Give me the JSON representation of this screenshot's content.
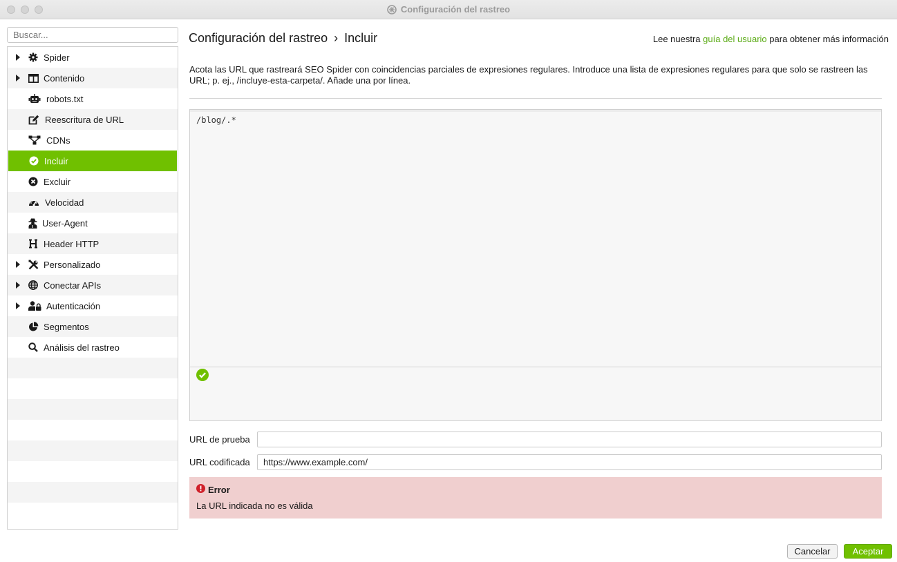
{
  "window": {
    "title": "Configuración del rastreo"
  },
  "sidebar": {
    "search_placeholder": "Buscar...",
    "items": [
      {
        "label": "Spider",
        "icon": "gear-icon",
        "expandable": true,
        "active": false
      },
      {
        "label": "Contenido",
        "icon": "columns-icon",
        "expandable": true,
        "active": false
      },
      {
        "label": "robots.txt",
        "icon": "robot-icon",
        "expandable": false,
        "active": false
      },
      {
        "label": "Reescritura de URL",
        "icon": "edit-icon",
        "expandable": false,
        "active": false
      },
      {
        "label": "CDNs",
        "icon": "network-icon",
        "expandable": false,
        "active": false
      },
      {
        "label": "Incluir",
        "icon": "check-circle-icon",
        "expandable": false,
        "active": true
      },
      {
        "label": "Excluir",
        "icon": "x-circle-icon",
        "expandable": false,
        "active": false
      },
      {
        "label": "Velocidad",
        "icon": "gauge-icon",
        "expandable": false,
        "active": false
      },
      {
        "label": "User-Agent",
        "icon": "user-secret-icon",
        "expandable": false,
        "active": false
      },
      {
        "label": "Header HTTP",
        "icon": "header-h-icon",
        "expandable": false,
        "active": false
      },
      {
        "label": "Personalizado",
        "icon": "tools-icon",
        "expandable": true,
        "active": false
      },
      {
        "label": "Conectar APIs",
        "icon": "globe-icon",
        "expandable": true,
        "active": false
      },
      {
        "label": "Autenticación",
        "icon": "user-lock-icon",
        "expandable": true,
        "active": false
      },
      {
        "label": "Segmentos",
        "icon": "pie-chart-icon",
        "expandable": false,
        "active": false
      },
      {
        "label": "Análisis del rastreo",
        "icon": "search-icon",
        "expandable": false,
        "active": false
      }
    ]
  },
  "header": {
    "breadcrumb_root": "Configuración del rastreo",
    "breadcrumb_sep": "›",
    "breadcrumb_current": "Incluir",
    "help_prefix": "Lee nuestra",
    "help_link": "guía del usuario",
    "help_suffix": "para obtener más información"
  },
  "main": {
    "description": "Acota las URL que rastreará SEO Spider con coincidencias parciales de expresiones regulares. Introduce una lista de expresiones regulares para que solo se rastreen las URL; p. ej., /incluye-esta-carpeta/. Añade una por línea.",
    "regex_text": "/blog/.*",
    "test_url_label": "URL de prueba",
    "test_url_value": "",
    "encoded_url_label": "URL codificada",
    "encoded_url_value": "https://www.example.com/",
    "error_title": "Error",
    "error_message": "La URL indicada no es válida"
  },
  "footer": {
    "cancel_label": "Cancelar",
    "accept_label": "Aceptar"
  },
  "colors": {
    "accent": "#70c000",
    "link": "#5aaa14",
    "error_bg": "#f0cfcf",
    "error_icon": "#d0202a"
  }
}
